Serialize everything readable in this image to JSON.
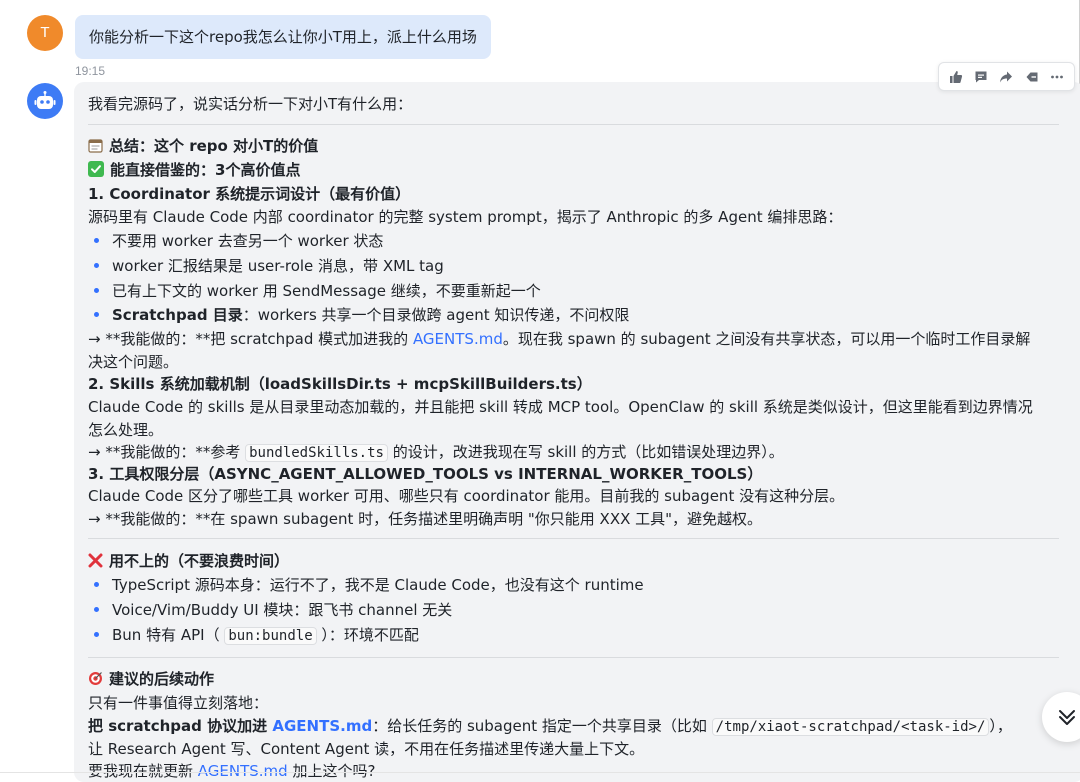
{
  "user_message": {
    "avatar_letter": "T",
    "text": "你能分析一下这个repo我怎么让你小T用上，派上什么用场",
    "time": "19:15"
  },
  "toolbar": {
    "icons": [
      "thumbs-up-icon",
      "comment-icon",
      "forward-icon",
      "reply-icon",
      "more-icon"
    ]
  },
  "bot_message": {
    "intro": "我看完源码了，说实话分析一下对小T有什么用：",
    "summary_title": "总结：这个 repo 对小T的价值",
    "reusable_title": "能直接借鉴的：3个高价值点",
    "point1": {
      "title": "1. Coordinator 系统提示词设计（最有价值）",
      "desc": "源码里有 Claude Code 内部 coordinator 的完整 system prompt，揭示了 Anthropic 的多 Agent 编排思路：",
      "bullets": [
        "不要用 worker 去查另一个 worker 状态",
        "worker 汇报结果是 user-role 消息，带 XML tag",
        "已有上下文的 worker 用 SendMessage 继续，不要重新起一个"
      ],
      "bullet4_bold": "Scratchpad 目录",
      "bullet4_rest": "：workers 共享一个目录做跨 agent 知识传递，不问权限",
      "action_prefix": "→ **我能做的：**把 scratchpad 模式加进我的 ",
      "action_link": "AGENTS.md",
      "action_suffix": "。现在我 spawn 的 subagent 之间没有共享状态，可以用一个临时工作目录解",
      "action_line2": "决这个问题。"
    },
    "point2": {
      "title": "2. Skills 系统加载机制（loadSkillsDir.ts + mcpSkillBuilders.ts）",
      "desc_line1": "Claude Code 的 skills 是从目录里动态加载的，并且能把 skill 转成 MCP tool。OpenClaw 的 skill 系统是类似设计，但这里能看到边界情况",
      "desc_line2": "怎么处理。",
      "action_prefix": "→ **我能做的：**参考 ",
      "action_code": "bundledSkills.ts",
      "action_suffix": " 的设计，改进我现在写 skill 的方式（比如错误处理边界）。"
    },
    "point3": {
      "title": "3. 工具权限分层（ASYNC_AGENT_ALLOWED_TOOLS vs INTERNAL_WORKER_TOOLS）",
      "desc": "Claude Code 区分了哪些工具 worker 可用、哪些只有 coordinator 能用。目前我的 subagent 没有这种分层。",
      "action": "→ **我能做的：**在 spawn subagent 时，任务描述里明确声明 \"你只能用 XXX 工具\"，避免越权。"
    },
    "not_useful": {
      "title": "用不上的（不要浪费时间）",
      "bullets": [
        "TypeScript 源码本身：运行不了，我不是 Claude Code，也没有这个 runtime",
        "Voice/Vim/Buddy UI 模块：跟飞书 channel 无关"
      ],
      "bullet3_prefix": "Bun 特有 API（ ",
      "bullet3_code": "bun:bundle",
      "bullet3_suffix": " ）：环境不匹配"
    },
    "next_steps": {
      "title": "建议的后续动作",
      "line1": "只有一件事值得立刻落地：",
      "line2_bold_prefix": "把 scratchpad 协议加进 ",
      "line2_bold_link": "AGENTS.md",
      "line2_rest": "：给长任务的 subagent 指定一个共享目录（比如 ",
      "line2_code": "/tmp/xiaot-scratchpad/<task-id>/",
      "line2_end": "），",
      "line3": "让 Research Agent 写、Content Agent 读，不用在任务描述里传递大量上下文。",
      "line4_prefix": "要我现在就更新 ",
      "line4_link": "AGENTS.md",
      "line4_suffix": " 加上这个吗?"
    }
  },
  "colors": {
    "accent": "#3370ff",
    "user_bubble": "#dde9fb",
    "bot_bubble": "#f2f3f5",
    "avatar_user": "#f08a2b",
    "avatar_bot": "#3d7bf5"
  }
}
